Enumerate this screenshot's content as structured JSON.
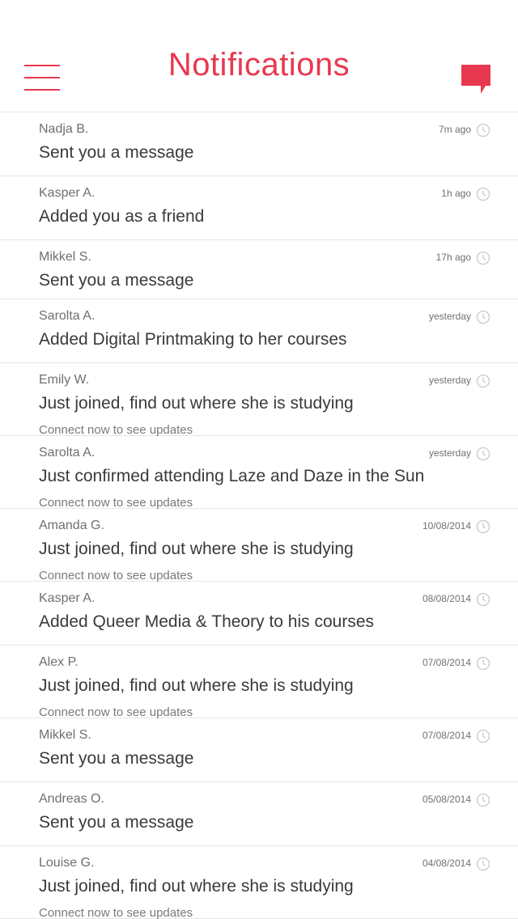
{
  "header": {
    "title": "Notifications",
    "menu_icon": "hamburger-menu-icon",
    "chat_icon": "speech-bubble-icon",
    "accent_color": "#e8384f"
  },
  "notifications": [
    {
      "name": "Nadja B.",
      "action": "Sent you a message",
      "sub": "",
      "time": "7m ago"
    },
    {
      "name": "Kasper A.",
      "action": "Added you as a friend",
      "sub": "",
      "time": "1h ago"
    },
    {
      "name": "Mikkel S.",
      "action": "Sent you a message",
      "sub": "",
      "time": "17h ago"
    },
    {
      "name": "Sarolta A.",
      "action": "Added Digital Printmaking to her courses",
      "sub": "",
      "time": "yesterday"
    },
    {
      "name": "Emily W.",
      "action": "Just joined, find out where she is studying",
      "sub": "Connect now to see updates",
      "time": "yesterday"
    },
    {
      "name": "Sarolta A.",
      "action": "Just confirmed attending Laze and Daze in the Sun",
      "sub": "Connect now to see updates",
      "time": "yesterday"
    },
    {
      "name": "Amanda G.",
      "action": "Just joined, find out where she is studying",
      "sub": "Connect now to see updates",
      "time": "10/08/2014"
    },
    {
      "name": "Kasper A.",
      "action": "Added Queer Media & Theory to his courses",
      "sub": "",
      "time": "08/08/2014"
    },
    {
      "name": "Alex P.",
      "action": "Just joined, find out where she is studying",
      "sub": "Connect now to see updates",
      "time": "07/08/2014"
    },
    {
      "name": "Mikkel S.",
      "action": "Sent you a message",
      "sub": "",
      "time": "07/08/2014"
    },
    {
      "name": "Andreas O.",
      "action": "Sent you a message",
      "sub": "",
      "time": "05/08/2014"
    },
    {
      "name": "Louise G.",
      "action": "Just joined, find out where she is studying",
      "sub": "Connect now to see updates",
      "time": "04/08/2014"
    }
  ]
}
